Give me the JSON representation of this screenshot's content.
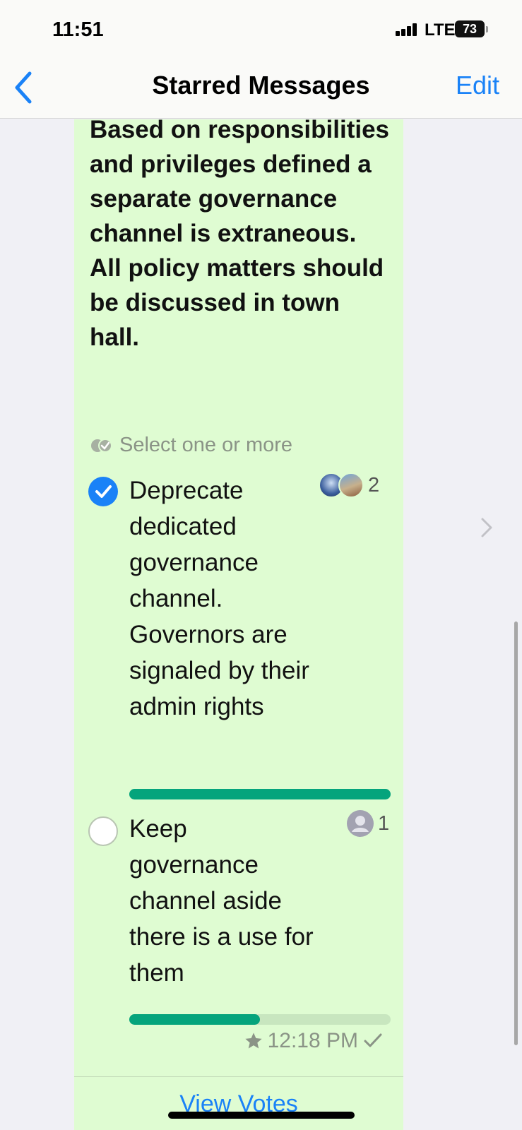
{
  "status_bar": {
    "time": "11:51",
    "network": "LTE",
    "battery": "73"
  },
  "nav": {
    "title": "Starred Messages",
    "edit_label": "Edit",
    "back_icon": "chevron-left-icon"
  },
  "poll": {
    "question": "Based on responsibilities and privileges defined a separate governance channel is extraneous. All policy matters should be discussed in town hall.",
    "select_hint": "Select one or more",
    "options": [
      {
        "text": "Deprecate dedicated governance channel. Governors are signaled by their admin rights",
        "votes": "2",
        "selected": true,
        "progress": 1.0
      },
      {
        "text": "Keep governance channel aside there is a use for them",
        "votes": "1",
        "selected": false,
        "progress": 0.5
      }
    ],
    "timestamp": "12:18 PM",
    "starred": true,
    "view_votes_label": "View Votes"
  },
  "colors": {
    "accent": "#1a82f7",
    "bubble": "#dffcd2",
    "progress": "#05a47c",
    "background": "#f0f0f5"
  }
}
